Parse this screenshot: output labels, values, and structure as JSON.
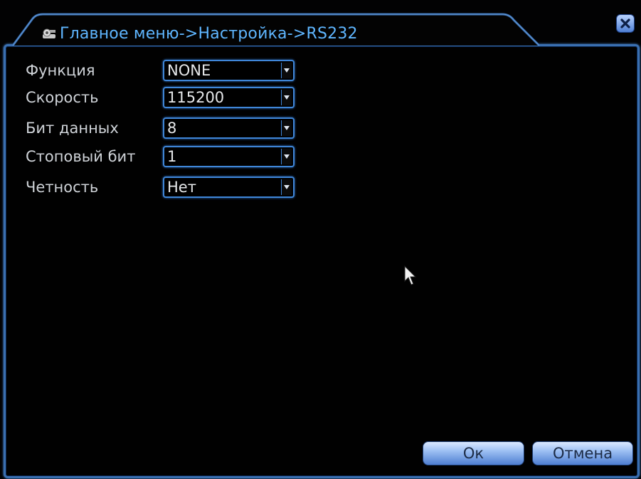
{
  "window": {
    "title": "Главное меню->Настройка->RS232"
  },
  "form": {
    "rows": [
      {
        "label": "Функция",
        "value": "NONE"
      },
      {
        "label": "Скорость",
        "value": "115200"
      },
      {
        "label": "Бит данных",
        "value": "8"
      },
      {
        "label": "Стоповый бит",
        "value": "1"
      },
      {
        "label": "Четность",
        "value": "Нет"
      }
    ]
  },
  "buttons": {
    "ok": "Ок",
    "cancel": "Отмена"
  },
  "colors": {
    "frame": "#3a6fb0",
    "title_text": "#5fb6ff",
    "field_border": "#3f86d8",
    "label_text": "#cfd3d8"
  },
  "icons": {
    "title": "settings-tool-icon",
    "close": "close-icon",
    "dropdown": "chevron-down-icon",
    "cursor": "mouse-pointer-icon"
  }
}
